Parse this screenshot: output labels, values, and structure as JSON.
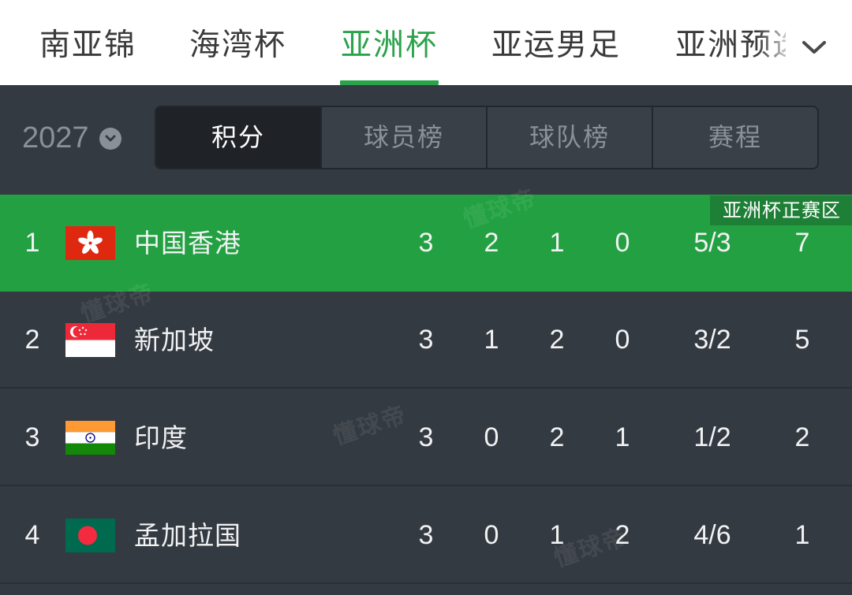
{
  "tabs": [
    {
      "label": "南亚锦"
    },
    {
      "label": "海湾杯"
    },
    {
      "label": "亚洲杯"
    },
    {
      "label": "亚运男足"
    },
    {
      "label": "亚洲预选"
    }
  ],
  "active_tab_index": 2,
  "filter": {
    "year": "2027",
    "segments": [
      {
        "label": "积分"
      },
      {
        "label": "球员榜"
      },
      {
        "label": "球队榜"
      },
      {
        "label": "赛程"
      }
    ],
    "active_segment_index": 0
  },
  "zone_badge": "亚洲杯正赛区",
  "standings": [
    {
      "rank": "1",
      "team": "中国香港",
      "flag": "hong-kong-flag",
      "played": "3",
      "won": "2",
      "drawn": "1",
      "lost": "0",
      "goals": "5/3",
      "points": "7"
    },
    {
      "rank": "2",
      "team": "新加坡",
      "flag": "singapore-flag",
      "played": "3",
      "won": "1",
      "drawn": "2",
      "lost": "0",
      "goals": "3/2",
      "points": "5"
    },
    {
      "rank": "3",
      "team": "印度",
      "flag": "india-flag",
      "played": "3",
      "won": "0",
      "drawn": "2",
      "lost": "1",
      "goals": "1/2",
      "points": "2"
    },
    {
      "rank": "4",
      "team": "孟加拉国",
      "flag": "bangladesh-flag",
      "played": "3",
      "won": "0",
      "drawn": "1",
      "lost": "2",
      "goals": "4/6",
      "points": "1"
    }
  ],
  "watermark": "懂球帝",
  "colors": {
    "accent": "#2aa34a",
    "highlight_row": "#23a142",
    "badge": "#1e7f36",
    "background": "#343a41"
  }
}
